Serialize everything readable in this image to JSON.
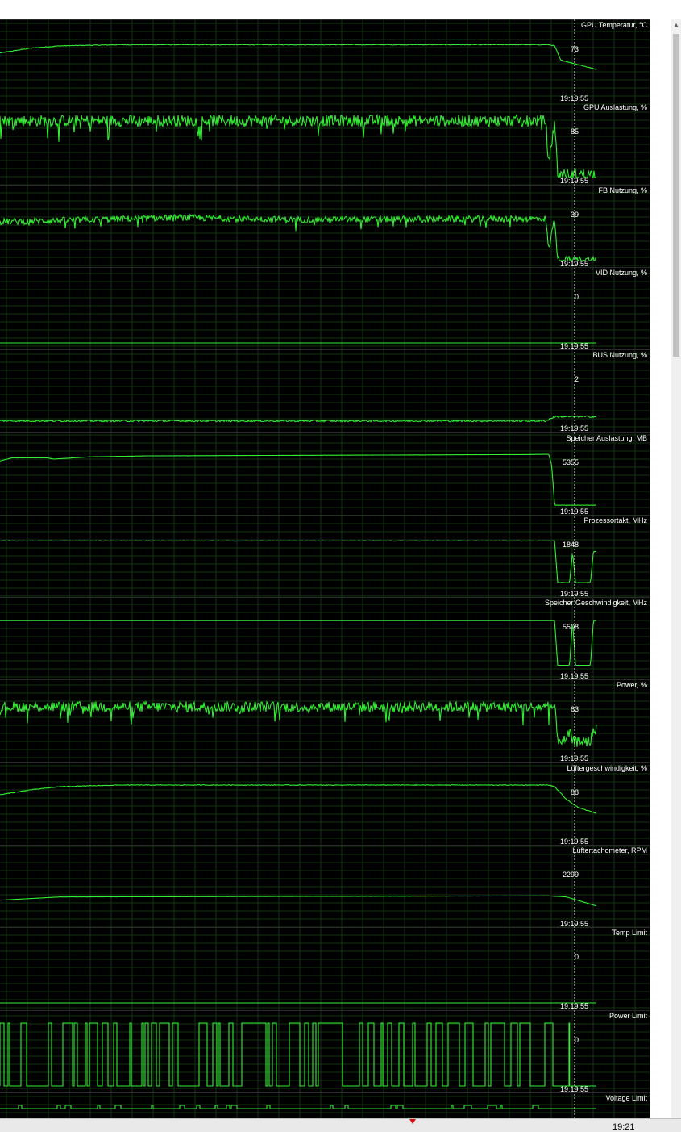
{
  "cursor_time": "19:19:55",
  "taskbar": {
    "clock": "19:21"
  },
  "colors": {
    "background": "#000000",
    "grid": "#123412",
    "line": "#33ee33",
    "text": "#ffffff",
    "cursor": "#e8e8e8"
  },
  "graphs": [
    {
      "id": "gpu-temperature",
      "title": "GPU Temperatur, °C",
      "cursor_value": "73",
      "current_value": "52",
      "time_label": "19:19:55",
      "min": 30,
      "max": 85,
      "profile": [
        [
          0,
          66
        ],
        [
          0.05,
          70
        ],
        [
          0.1,
          72
        ],
        [
          0.2,
          73
        ],
        [
          0.92,
          73
        ],
        [
          0.93,
          72
        ],
        [
          0.94,
          60
        ],
        [
          1,
          52
        ]
      ],
      "noise": 0.3
    },
    {
      "id": "gpu-load",
      "title": "GPU Auslastung, %",
      "cursor_value": "85",
      "current_value": "5",
      "time_label": "19:19:55",
      "min": 0,
      "max": 100,
      "profile": [
        [
          0,
          88
        ],
        [
          0.915,
          88
        ],
        [
          0.92,
          20
        ],
        [
          0.93,
          88
        ],
        [
          0.935,
          5
        ],
        [
          1,
          5
        ]
      ],
      "noise": 9,
      "spiky": true
    },
    {
      "id": "fb-usage",
      "title": "FB Nutzung, %",
      "cursor_value": "39",
      "current_value": "1",
      "time_label": "19:19:55",
      "min": 0,
      "max": 60,
      "profile": [
        [
          0,
          36
        ],
        [
          0.3,
          40
        ],
        [
          0.5,
          38
        ],
        [
          0.915,
          39
        ],
        [
          0.92,
          10
        ],
        [
          0.93,
          40
        ],
        [
          0.935,
          1
        ],
        [
          1,
          1
        ]
      ],
      "noise": 3,
      "spiky": true
    },
    {
      "id": "vid-usage",
      "title": "VID Nutzung, %",
      "cursor_value": "0",
      "current_value": "0",
      "time_label": "19:19:55",
      "min": 0,
      "max": 100,
      "profile": [
        [
          0,
          0
        ],
        [
          1,
          0
        ]
      ],
      "noise": 0
    },
    {
      "id": "bus-usage",
      "title": "BUS Nutzung, %",
      "cursor_value": "2",
      "current_value": "4",
      "time_label": "19:19:55",
      "min": 0,
      "max": 30,
      "profile": [
        [
          0,
          2
        ],
        [
          0.915,
          2
        ],
        [
          0.93,
          4
        ],
        [
          1,
          4
        ]
      ],
      "noise": 0.4
    },
    {
      "id": "memory-usage",
      "title": "Speicher Auslastung, MB",
      "cursor_value": "5355",
      "current_value": "308",
      "time_label": "19:19:55",
      "min": 0,
      "max": 6400,
      "profile": [
        [
          0,
          4700
        ],
        [
          0.02,
          5000
        ],
        [
          0.08,
          5000
        ],
        [
          0.09,
          4880
        ],
        [
          0.15,
          5100
        ],
        [
          0.25,
          5200
        ],
        [
          0.5,
          5250
        ],
        [
          0.88,
          5330
        ],
        [
          0.92,
          5355
        ],
        [
          0.925,
          4300
        ],
        [
          0.93,
          308
        ],
        [
          1,
          308
        ]
      ],
      "noise": 5
    },
    {
      "id": "core-clock",
      "title": "Prozessortakt, MHz",
      "cursor_value": "1848",
      "current_value": "1455",
      "time_label": "19:19:55",
      "min": 0,
      "max": 2400,
      "profile": [
        [
          0,
          1848
        ],
        [
          0.92,
          1848
        ],
        [
          0.93,
          1848
        ],
        [
          0.935,
          300
        ],
        [
          0.955,
          300
        ],
        [
          0.96,
          1455
        ],
        [
          0.965,
          300
        ],
        [
          0.99,
          300
        ],
        [
          0.995,
          1455
        ],
        [
          1,
          1455
        ]
      ],
      "noise": 6
    },
    {
      "id": "memory-clock",
      "title": "Speicher Geschwindigkeit, MHz",
      "cursor_value": "5508",
      "current_value": "5508",
      "time_label": "19:19:55",
      "min": 0,
      "max": 6800,
      "profile": [
        [
          0,
          5508
        ],
        [
          0.93,
          5508
        ],
        [
          0.935,
          810
        ],
        [
          0.955,
          810
        ],
        [
          0.96,
          5508
        ],
        [
          0.965,
          810
        ],
        [
          0.99,
          810
        ],
        [
          0.995,
          5508
        ],
        [
          1,
          5508
        ]
      ],
      "noise": 0
    },
    {
      "id": "power",
      "title": "Power, %",
      "cursor_value": "63",
      "current_value": "44",
      "time_label": "19:19:55",
      "min": 20,
      "max": 80,
      "profile": [
        [
          0,
          65
        ],
        [
          0.93,
          65
        ],
        [
          0.935,
          35
        ],
        [
          0.95,
          33
        ],
        [
          0.955,
          42
        ],
        [
          0.96,
          33
        ],
        [
          0.99,
          33
        ],
        [
          0.995,
          44
        ],
        [
          1,
          44
        ]
      ],
      "noise": 5,
      "spiky": true
    },
    {
      "id": "fan-speed",
      "title": "Lüftergeschwindigkeit, %",
      "cursor_value": "88",
      "current_value": "51",
      "time_label": "19:19:55",
      "min": 20,
      "max": 100,
      "profile": [
        [
          0,
          74
        ],
        [
          0.05,
          80
        ],
        [
          0.1,
          84
        ],
        [
          0.2,
          86
        ],
        [
          0.92,
          86
        ],
        [
          0.93,
          84
        ],
        [
          0.95,
          68
        ],
        [
          0.97,
          58
        ],
        [
          1,
          51
        ]
      ],
      "noise": 0.4
    },
    {
      "id": "fan-tach",
      "title": "Lüftertachometer, RPM",
      "cursor_value": "2299",
      "current_value": "1365",
      "time_label": "19:19:55",
      "min": 0,
      "max": 6000,
      "profile": [
        [
          0,
          1900
        ],
        [
          0.1,
          2200
        ],
        [
          0.92,
          2299
        ],
        [
          0.95,
          2200
        ],
        [
          1,
          1365
        ]
      ],
      "noise": 5
    },
    {
      "id": "temp-limit",
      "title": "Temp Limit",
      "cursor_value": "0",
      "current_value": "0",
      "time_label": "19:19:55",
      "min": 0,
      "max": 1,
      "profile": [
        [
          0,
          0
        ],
        [
          1,
          0
        ]
      ],
      "noise": 0
    },
    {
      "id": "power-limit",
      "title": "Power Limit",
      "cursor_value": "0",
      "current_value": "0",
      "time_label": "19:19:55",
      "min": 0,
      "max": 1,
      "profile": [
        [
          0,
          0
        ],
        [
          1,
          0
        ]
      ],
      "noise": 0,
      "binary": true,
      "density": 0.5,
      "end": 0.955
    },
    {
      "id": "voltage-limit",
      "title": "Voltage Limit",
      "cursor_value": "",
      "current_value": "",
      "time_label": "",
      "min": 0,
      "max": 1,
      "profile": [
        [
          0,
          0
        ],
        [
          1,
          0
        ]
      ],
      "noise": 0,
      "binary": true,
      "density": 0.12,
      "end": 0.92,
      "partial": true
    }
  ]
}
